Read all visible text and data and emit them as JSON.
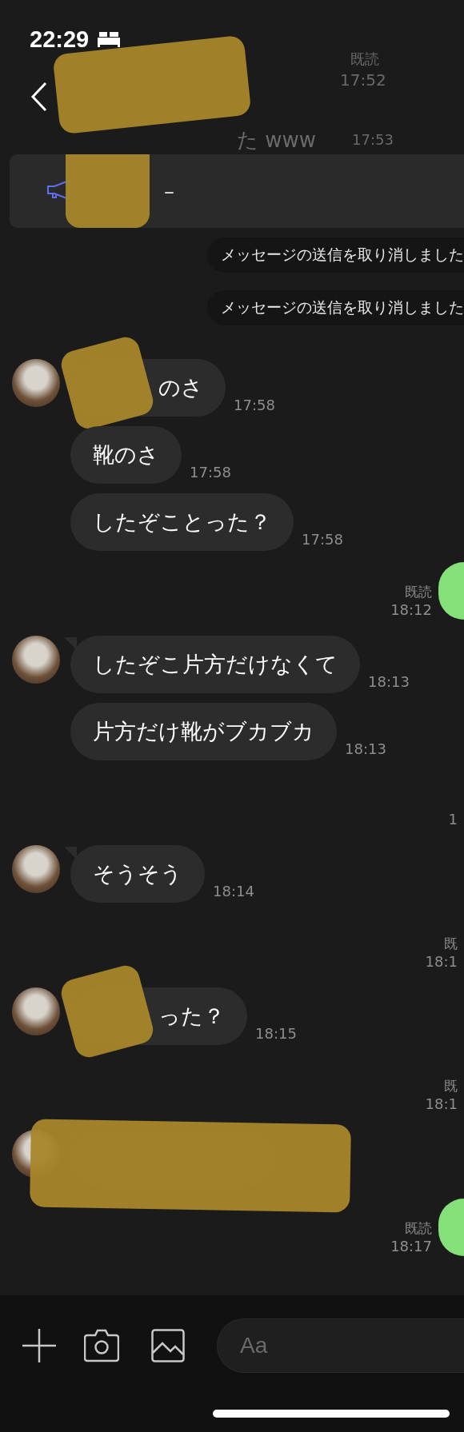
{
  "status_bar": {
    "time": "22:29",
    "sleep_focus": true
  },
  "header": {
    "title_redacted": true,
    "behind": [
      {
        "kind": "read",
        "text": "既読"
      },
      {
        "kind": "time",
        "text": "17:52"
      },
      {
        "kind": "message",
        "text": "た www"
      },
      {
        "kind": "time2",
        "text": "17:53"
      }
    ]
  },
  "announcement": {
    "text": "–",
    "redacted": true
  },
  "messages": [
    {
      "kind": "recalled",
      "text": "メッセージの送信を取り消しました"
    },
    {
      "kind": "recalled",
      "text": "メッセージの送信を取り消しました"
    },
    {
      "kind": "incoming",
      "avatar": true,
      "text": "のさ",
      "time": "17:58",
      "redacted": true
    },
    {
      "kind": "incoming",
      "avatar": false,
      "text": "靴のさ",
      "time": "17:58",
      "redacted": false
    },
    {
      "kind": "incoming",
      "avatar": false,
      "text": "したぞことった？",
      "time": "17:58",
      "redacted": false
    },
    {
      "kind": "outgoing",
      "read": "既読",
      "time": "18:12",
      "bubble": true
    },
    {
      "kind": "incoming",
      "avatar": true,
      "text": "したぞこ片方だけなくて",
      "time": "18:13",
      "redacted": false
    },
    {
      "kind": "incoming",
      "avatar": false,
      "text": "片方だけ靴がブカブカ",
      "time": "18:13",
      "redacted": false
    },
    {
      "kind": "outgoing",
      "time": "1",
      "bubble": false
    },
    {
      "kind": "incoming",
      "avatar": true,
      "text": "そうそう",
      "time": "18:14",
      "redacted": false
    },
    {
      "kind": "outgoing",
      "read": "既",
      "time": "18:1",
      "bubble": false
    },
    {
      "kind": "incoming",
      "avatar": true,
      "text": "った？",
      "time": "18:15",
      "redacted": true
    },
    {
      "kind": "outgoing",
      "read": "既",
      "time": "18:1",
      "bubble": false
    },
    {
      "kind": "incoming",
      "avatar": true,
      "redacted": true
    },
    {
      "kind": "outgoing",
      "read": "既読",
      "time": "18:17",
      "bubble": true
    }
  ],
  "composer": {
    "placeholder": "Aa"
  }
}
